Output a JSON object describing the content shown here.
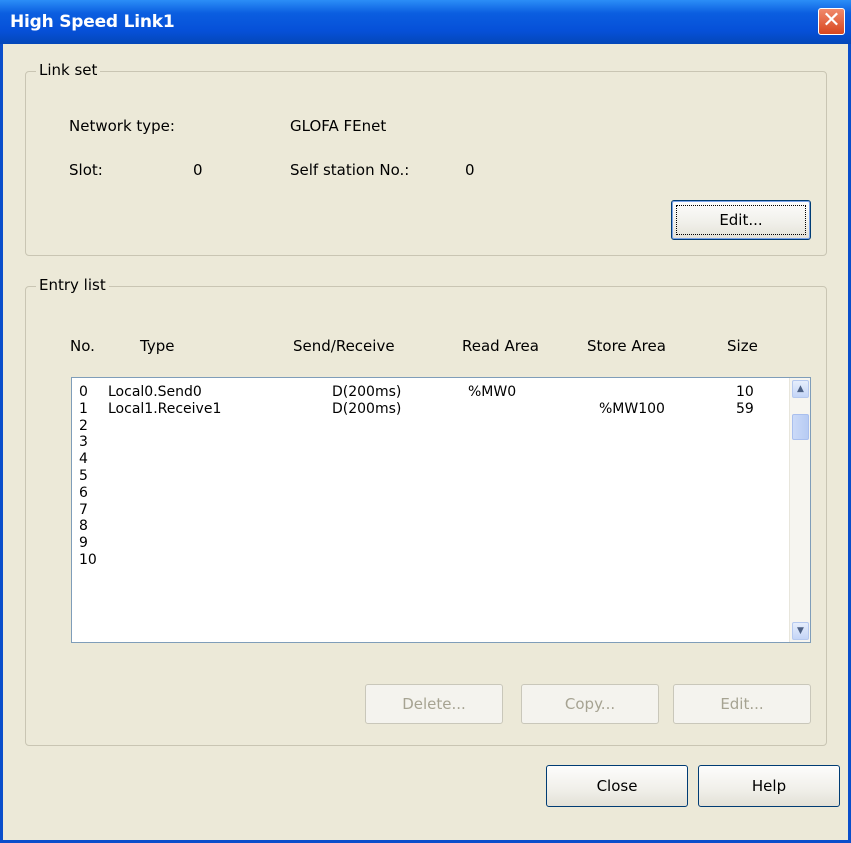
{
  "window": {
    "title": "High Speed Link1",
    "close_glyph": "✕"
  },
  "link_set": {
    "legend": "Link set",
    "network_type_label": "Network type:",
    "network_type_value": "GLOFA FEnet",
    "slot_label": "Slot:",
    "slot_value": "0",
    "self_station_label": "Self station No.:",
    "self_station_value": "0",
    "edit_label": "Edit..."
  },
  "entry_list": {
    "legend": "Entry list",
    "columns": [
      "No.",
      "Type",
      "Send/Receive",
      "Read Area",
      "Store Area",
      "Size"
    ],
    "rows": [
      {
        "no": "0",
        "type": "Local0.Send0",
        "send_receive": "D(200ms)",
        "read_area": "%MW0",
        "store_area": "",
        "size": "10"
      },
      {
        "no": "1",
        "type": "Local1.Receive1",
        "send_receive": "D(200ms)",
        "read_area": "",
        "store_area": "%MW100",
        "size": "59"
      },
      {
        "no": "2",
        "type": "",
        "send_receive": "",
        "read_area": "",
        "store_area": "",
        "size": ""
      },
      {
        "no": "3",
        "type": "",
        "send_receive": "",
        "read_area": "",
        "store_area": "",
        "size": ""
      },
      {
        "no": "4",
        "type": "",
        "send_receive": "",
        "read_area": "",
        "store_area": "",
        "size": ""
      },
      {
        "no": "5",
        "type": "",
        "send_receive": "",
        "read_area": "",
        "store_area": "",
        "size": ""
      },
      {
        "no": "6",
        "type": "",
        "send_receive": "",
        "read_area": "",
        "store_area": "",
        "size": ""
      },
      {
        "no": "7",
        "type": "",
        "send_receive": "",
        "read_area": "",
        "store_area": "",
        "size": ""
      },
      {
        "no": "8",
        "type": "",
        "send_receive": "",
        "read_area": "",
        "store_area": "",
        "size": ""
      },
      {
        "no": "9",
        "type": "",
        "send_receive": "",
        "read_area": "",
        "store_area": "",
        "size": ""
      },
      {
        "no": "10",
        "type": "",
        "send_receive": "",
        "read_area": "",
        "store_area": "",
        "size": ""
      }
    ],
    "delete_label": "Delete...",
    "copy_label": "Copy...",
    "edit_label": "Edit..."
  },
  "footer": {
    "close_label": "Close",
    "help_label": "Help"
  },
  "colors": {
    "title_bar": "#0650d8",
    "dialog_bg": "#ECE9D8",
    "close_button": "#d8461f"
  },
  "icons": {
    "scroll_up": "chevron-up-icon",
    "scroll_down": "chevron-down-icon",
    "window_close": "close-icon"
  }
}
